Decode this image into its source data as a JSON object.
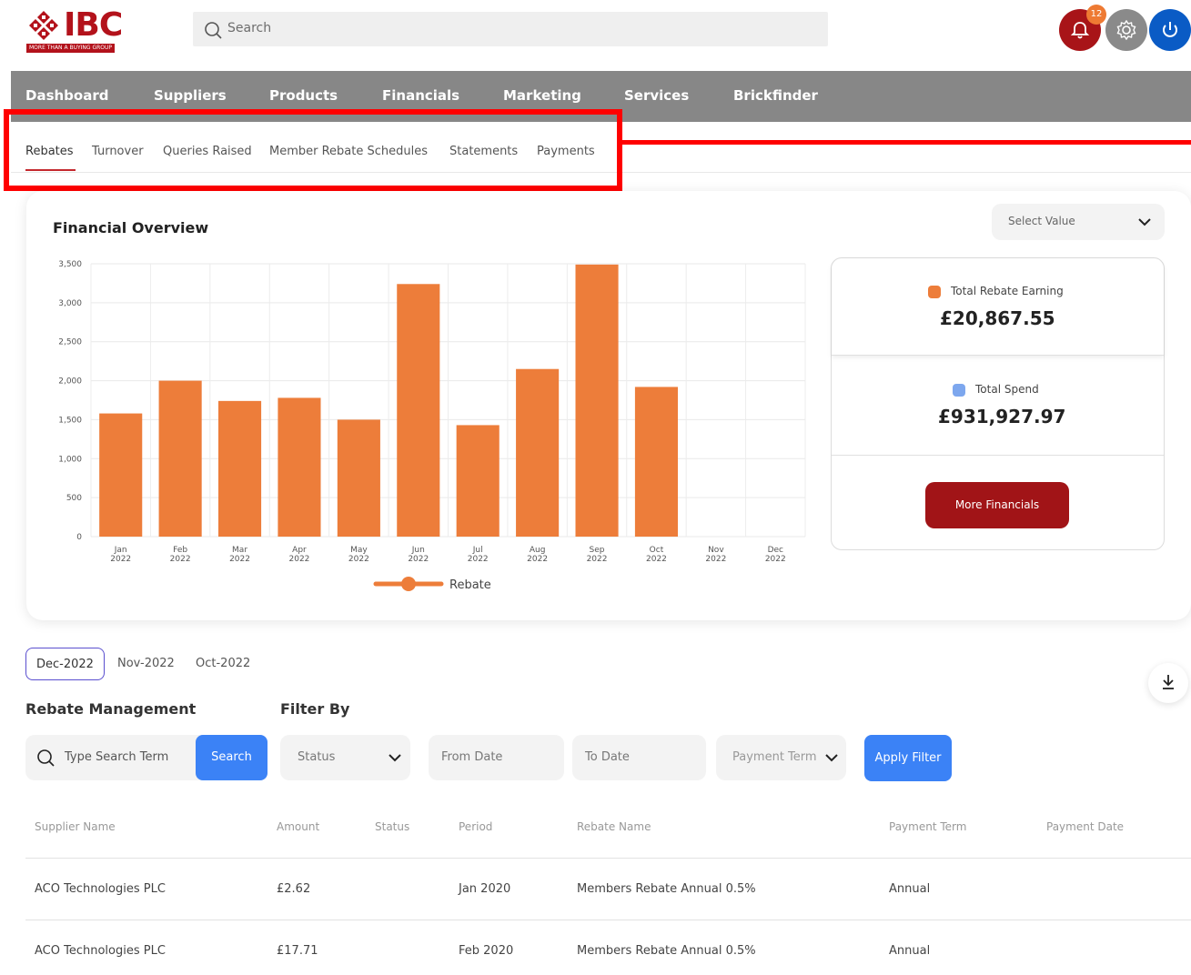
{
  "header": {
    "logo_text": "IBC",
    "logo_tagline": "MORE THAN A BUYING GROUP",
    "search_placeholder": "Search",
    "notification_count": "12"
  },
  "main_nav": [
    "Dashboard",
    "Suppliers",
    "Products",
    "Financials",
    "Marketing",
    "Services",
    "Brickfinder"
  ],
  "sub_nav": [
    "Rebates",
    "Turnover",
    "Queries Raised",
    "Member Rebate Schedules",
    "Statements",
    "Payments"
  ],
  "overview": {
    "title": "Financial Overview",
    "select_placeholder": "Select Value",
    "total_rebate_label": "Total Rebate Earning",
    "total_rebate_value": "£20,867.55",
    "total_spend_label": "Total Spend",
    "total_spend_value": "£931,927.97",
    "more_button": "More Financials",
    "colors": {
      "rebate": "#ed7d3a",
      "spend": "#7da7ee",
      "button": "#a11417"
    }
  },
  "chart_data": {
    "type": "bar",
    "categories": [
      "Jan 2022",
      "Feb 2022",
      "Mar 2022",
      "Apr 2022",
      "May 2022",
      "Jun 2022",
      "Jul 2022",
      "Aug 2022",
      "Sep 2022",
      "Oct 2022",
      "Nov 2022",
      "Dec 2022"
    ],
    "category_lines": [
      [
        "Jan",
        "2022"
      ],
      [
        "Feb",
        "2022"
      ],
      [
        "Mar",
        "2022"
      ],
      [
        "Apr",
        "2022"
      ],
      [
        "May",
        "2022"
      ],
      [
        "Jun",
        "2022"
      ],
      [
        "Jul",
        "2022"
      ],
      [
        "Aug",
        "2022"
      ],
      [
        "Sep",
        "2022"
      ],
      [
        "Oct",
        "2022"
      ],
      [
        "Nov",
        "2022"
      ],
      [
        "Dec",
        "2022"
      ]
    ],
    "series": [
      {
        "name": "Rebate",
        "color": "#ed7d3a",
        "values": [
          1580,
          2000,
          1740,
          1780,
          1500,
          3240,
          1430,
          2150,
          3490,
          1920,
          0,
          0
        ]
      }
    ],
    "ylim": [
      0,
      3500
    ],
    "yticks": [
      0,
      500,
      1000,
      1500,
      2000,
      2500,
      3000,
      3500
    ],
    "ytick_labels": [
      "0",
      "500",
      "1,000",
      "1,500",
      "2,000",
      "2,500",
      "3,000",
      "3,500"
    ],
    "grid": true,
    "legend": "bottom"
  },
  "periods": [
    "Dec-2022",
    "Nov-2022",
    "Oct-2022"
  ],
  "rebate_management": {
    "title": "Rebate Management",
    "filter_title": "Filter By",
    "search_placeholder": "Type Search Term",
    "search_button": "Search",
    "status_placeholder": "Status",
    "from_date_placeholder": "From Date",
    "to_date_placeholder": "To Date",
    "payment_term_placeholder": "Payment Term",
    "apply_button": "Apply Filter"
  },
  "table": {
    "columns": [
      "Supplier Name",
      "Amount",
      "Status",
      "Period",
      "Rebate Name",
      "Payment Term",
      "Payment Date"
    ],
    "rows": [
      [
        "ACO Technologies PLC",
        "£2.62",
        "",
        "Jan 2020",
        "Members Rebate Annual 0.5%",
        "Annual",
        ""
      ],
      [
        "ACO Technologies PLC",
        "£17.71",
        "",
        "Feb 2020",
        "Members Rebate Annual 0.5%",
        "Annual",
        ""
      ]
    ]
  }
}
